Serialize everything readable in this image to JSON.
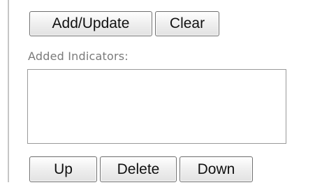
{
  "buttons": {
    "add_update": "Add/Update",
    "clear": "Clear",
    "up": "Up",
    "delete": "Delete",
    "down": "Down"
  },
  "added_indicators": {
    "label": "Added Indicators:",
    "items": []
  }
}
